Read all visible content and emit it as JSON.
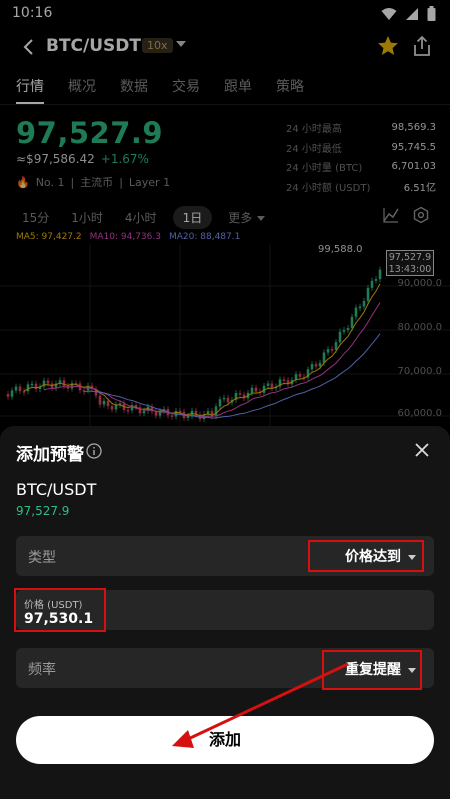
{
  "status": {
    "time": "10:16"
  },
  "header": {
    "pair": "BTC/USDT",
    "leverage": "10x"
  },
  "tabs": [
    "行情",
    "概况",
    "数据",
    "交易",
    "跟单",
    "策略"
  ],
  "price": {
    "last": "97,527.9",
    "converted": "≈$97,586.42",
    "change": "+1.67%",
    "rank": "No. 1",
    "tag1": "主流币",
    "tag2": "Layer 1"
  },
  "stats": [
    {
      "label": "24 小时最高",
      "value": "98,569.3"
    },
    {
      "label": "24 小时最低",
      "value": "95,745.5"
    },
    {
      "label": "24 小时量 (BTC)",
      "value": "6,701.03"
    },
    {
      "label": "24 小时额 (USDT)",
      "value": "6.51亿"
    }
  ],
  "intervals": [
    "15分",
    "1小时",
    "4小时",
    "1日",
    "更多"
  ],
  "ma": {
    "ma5": "MA5: 97,427.2",
    "ma10": "MA10: 94,736.3",
    "ma20": "MA20: 88,487.1"
  },
  "chart_labels": {
    "high": "99,588.0",
    "current_price": "97,527.9",
    "current_time": "13:43:00",
    "y_ticks": [
      "90,000.0",
      "80,000.0",
      "70,000.0",
      "60,000.0"
    ]
  },
  "colors": {
    "up": "#2ebd85",
    "down": "#e2445c",
    "highlight": "#d41010"
  },
  "sheet": {
    "title": "添加预警",
    "symbol": "BTC/USDT",
    "symbol_price": "97,527.9",
    "type_label": "类型",
    "type_value": "价格达到",
    "price_label": "价格 (USDT)",
    "price_value": "97,530.1",
    "freq_label": "频率",
    "freq_value": "重复提醒",
    "add_button": "添加"
  }
}
